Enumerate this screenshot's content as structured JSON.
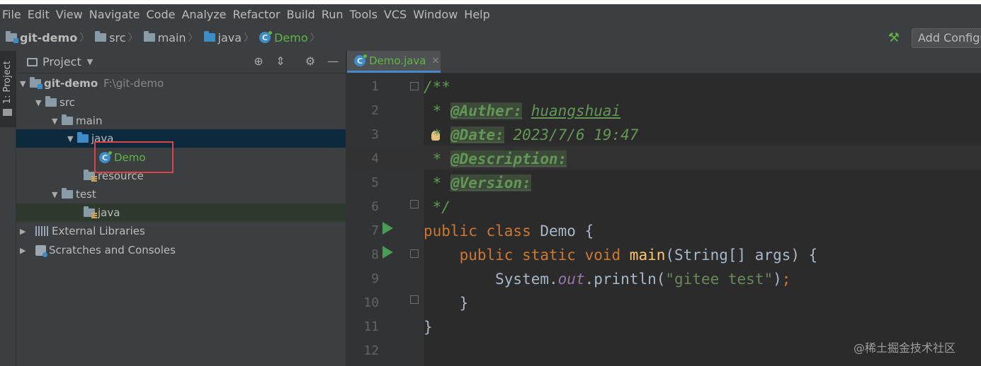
{
  "menu": [
    "File",
    "Edit",
    "View",
    "Navigate",
    "Code",
    "Analyze",
    "Refactor",
    "Build",
    "Run",
    "Tools",
    "VCS",
    "Window",
    "Help"
  ],
  "breadcrumb": [
    "git-demo",
    "src",
    "main",
    "java",
    "Demo"
  ],
  "toolbar": {
    "add_config": "Add Configu"
  },
  "left_tool": {
    "project_tab": "1: Project"
  },
  "project_panel": {
    "title": "Project",
    "tree": {
      "root": "git-demo",
      "root_path": "F:\\git-demo",
      "src": "src",
      "main": "main",
      "java": "java",
      "demo": "Demo",
      "resource": "resource",
      "test": "test",
      "test_java": "java",
      "external_libraries": "External Libraries",
      "scratches": "Scratches and Consoles"
    }
  },
  "editor": {
    "tab_label": "Demo.java",
    "line_numbers": [
      "1",
      "2",
      "3",
      "4",
      "5",
      "6",
      "7",
      "8",
      "9",
      "10",
      "11",
      "12"
    ],
    "code": {
      "l1": "/**",
      "l2_star": " * ",
      "l2_tag": "@Auther:",
      "l2_val": "huangshuai",
      "l3_star": " * ",
      "l3_tag": "@Date:",
      "l3_val": "2023/7/6 19:47",
      "l4_star": " * ",
      "l4_tag": "@Description:",
      "l5_star": " * ",
      "l5_tag": "@Version:",
      "l6": " */",
      "l7_kw": "public class",
      "l7_rest": " Demo {",
      "l8_kw": "    public static void",
      "l8_fn": " main",
      "l8_rest": "(String[] args) {",
      "l9_a": "        System.",
      "l9_field": "out",
      "l9_b": ".println(",
      "l9_str": "\"gitee test\"",
      "l9_c": ")",
      "l9_semi": ";",
      "l10": "    }",
      "l11": "}"
    }
  },
  "watermark": "@稀土掘金技术社区",
  "colors": {
    "background": "#2b2b2b",
    "panel": "#3c3f41",
    "keyword": "#cc7832",
    "doc": "#629755",
    "highlight_box": "#e04343"
  }
}
